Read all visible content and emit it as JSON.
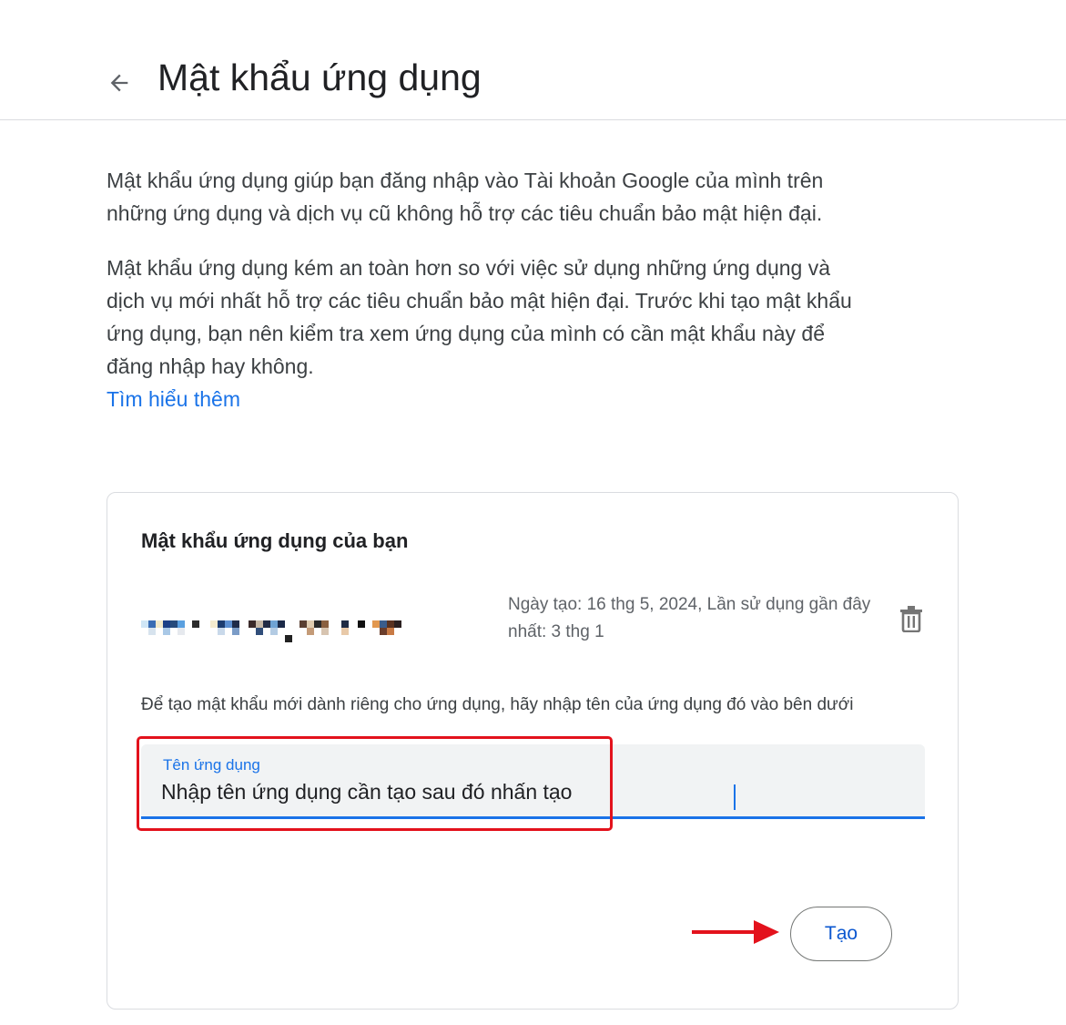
{
  "header": {
    "title": "Mật khẩu ứng dụng",
    "back_icon": "arrow-back-icon"
  },
  "intro": {
    "paragraph1": "Mật khẩu ứng dụng giúp bạn đăng nhập vào Tài khoản Google của mình trên những ứng dụng và dịch vụ cũ không hỗ trợ các tiêu chuẩn bảo mật hiện đại.",
    "paragraph2": "Mật khẩu ứng dụng kém an toàn hơn so với việc sử dụng những ứng dụng và dịch vụ mới nhất hỗ trợ các tiêu chuẩn bảo mật hiện đại. Trước khi tạo mật khẩu ứng dụng, bạn nên kiểm tra xem ứng dụng của mình có cần mật khẩu này để đăng nhập hay không.",
    "learn_more": "Tìm hiểu thêm"
  },
  "card": {
    "title": "Mật khẩu ứng dụng của bạn",
    "existing_password": {
      "meta": "Ngày tạo: 16 thg 5, 2024, Lần sử dụng gần đây nhất: 3 thg 1",
      "delete_icon": "trash-icon"
    },
    "create_instructions": "Để tạo mật khẩu mới dành riêng cho ứng dụng, hãy nhập tên của ứng dụng đó vào bên dưới",
    "field": {
      "label": "Tên ứng dụng",
      "value": "Nhập tên ứng dụng cần tạo sau đó nhấn tạo"
    },
    "create_button": "Tạo"
  },
  "colors": {
    "accent": "#1a73e8",
    "annotation": "#e3121c"
  }
}
